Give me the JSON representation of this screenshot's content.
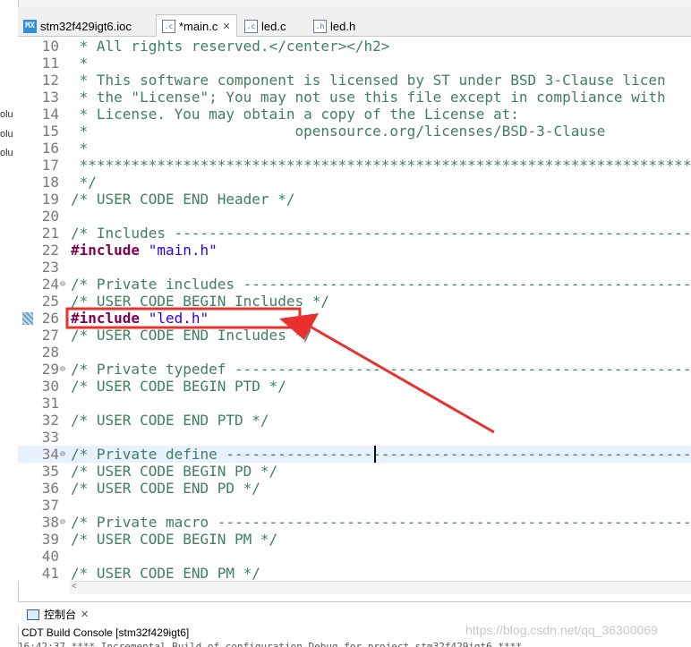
{
  "tabs": [
    {
      "icon": "mx-icon",
      "label": "stm32f429igt6.ioc",
      "active": false
    },
    {
      "icon": "c-file-icon",
      "label": "*main.c",
      "active": true,
      "closable": true
    },
    {
      "icon": "c-file-icon",
      "label": "led.c",
      "active": false
    },
    {
      "icon": "h-file-icon",
      "label": "led.h",
      "active": false
    }
  ],
  "left_fragments": [
    "olu",
    "olu",
    "olu"
  ],
  "editor": {
    "lines": [
      {
        "num": "10",
        "parts": [
          {
            "t": " * All rights reserved.</center></h2>",
            "c": "cm"
          }
        ]
      },
      {
        "num": "11",
        "parts": [
          {
            "t": " *",
            "c": "cm"
          }
        ]
      },
      {
        "num": "12",
        "parts": [
          {
            "t": " * This software component is licensed by ST under BSD 3-Clause licen",
            "c": "cm"
          }
        ]
      },
      {
        "num": "13",
        "parts": [
          {
            "t": " * the \"License\"; You may not use this file except in compliance with",
            "c": "cm"
          }
        ]
      },
      {
        "num": "14",
        "parts": [
          {
            "t": " * License. You may obtain a copy of the License at:",
            "c": "cm"
          }
        ]
      },
      {
        "num": "15",
        "parts": [
          {
            "t": " *                        opensource.org/licenses/BSD-3-Clause",
            "c": "cm"
          }
        ]
      },
      {
        "num": "16",
        "parts": [
          {
            "t": " *",
            "c": "cm"
          }
        ]
      },
      {
        "num": "17",
        "parts": [
          {
            "t": " ******************************************************************************",
            "c": "cm"
          }
        ]
      },
      {
        "num": "18",
        "parts": [
          {
            "t": " */",
            "c": "cm"
          }
        ]
      },
      {
        "num": "19",
        "parts": [
          {
            "t": "/* USER CODE END Header */",
            "c": "cm"
          }
        ]
      },
      {
        "num": "20",
        "parts": []
      },
      {
        "num": "21",
        "parts": [
          {
            "t": "/* Includes ------------------------------------------------------------------",
            "c": "cm"
          }
        ]
      },
      {
        "num": "22",
        "parts": [
          {
            "t": "#include ",
            "c": "kw"
          },
          {
            "t": "\"main.h\"",
            "c": "str"
          }
        ]
      },
      {
        "num": "23",
        "parts": []
      },
      {
        "num": "24",
        "fold": true,
        "parts": [
          {
            "t": "/* Private includes ----------------------------------------------------------",
            "c": "cm"
          }
        ]
      },
      {
        "num": "25",
        "parts": [
          {
            "t": "/* USER CODE BEGIN Includes */",
            "c": "cm"
          }
        ]
      },
      {
        "num": "26",
        "marker": true,
        "parts": [
          {
            "t": "#include ",
            "c": "kw"
          },
          {
            "t": "\"led.h\"",
            "c": "str"
          }
        ]
      },
      {
        "num": "27",
        "parts": [
          {
            "t": "/* USER CODE END Includes */",
            "c": "cm"
          }
        ]
      },
      {
        "num": "28",
        "parts": []
      },
      {
        "num": "29",
        "fold": true,
        "parts": [
          {
            "t": "/* Private typedef -----------------------------------------------------------",
            "c": "cm"
          }
        ]
      },
      {
        "num": "30",
        "parts": [
          {
            "t": "/* USER CODE BEGIN PTD */",
            "c": "cm"
          }
        ]
      },
      {
        "num": "31",
        "parts": []
      },
      {
        "num": "32",
        "parts": [
          {
            "t": "/* USER CODE END PTD */",
            "c": "cm"
          }
        ]
      },
      {
        "num": "33",
        "parts": []
      },
      {
        "num": "34",
        "fold": true,
        "highlight": true,
        "cursor": true,
        "parts": [
          {
            "t": "/* Private define ------------------------------------------------------------",
            "c": "cm"
          }
        ]
      },
      {
        "num": "35",
        "parts": [
          {
            "t": "/* USER CODE BEGIN PD */",
            "c": "cm"
          }
        ]
      },
      {
        "num": "36",
        "parts": [
          {
            "t": "/* USER CODE END PD */",
            "c": "cm"
          }
        ]
      },
      {
        "num": "37",
        "parts": []
      },
      {
        "num": "38",
        "fold": true,
        "parts": [
          {
            "t": "/* Private macro -------------------------------------------------------------",
            "c": "cm"
          }
        ]
      },
      {
        "num": "39",
        "parts": [
          {
            "t": "/* USER CODE BEGIN PM */",
            "c": "cm"
          }
        ]
      },
      {
        "num": "40",
        "parts": []
      },
      {
        "num": "41",
        "parts": [
          {
            "t": "/* USER CODE END PM */",
            "c": "cm"
          }
        ]
      }
    ]
  },
  "console": {
    "tab_label": "控制台",
    "title": "CDT Build Console [stm32f429igt6]",
    "output": "16:42:37 **** Incremental Build of configuration Debug for project stm32f429igt6 ****"
  },
  "watermark": "https://blog.csdn.net/qq_36300069",
  "colors": {
    "comment": "#3f7f5f",
    "keyword": "#7f0055",
    "string": "#2a00ff",
    "annotation": "#e8312f",
    "line_highlight": "#e8f2fe"
  }
}
